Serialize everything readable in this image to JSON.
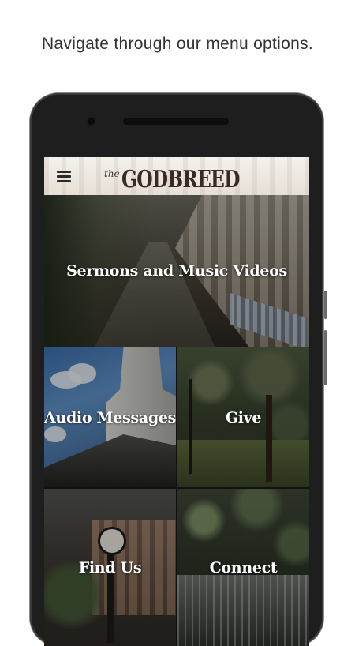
{
  "caption": "Navigate through our menu options.",
  "app": {
    "logo_small": "the",
    "logo_main": "GODBREED"
  },
  "tiles": [
    {
      "label": "Sermons and Music Videos"
    },
    {
      "label": "Audio Messages"
    },
    {
      "label": "Give"
    },
    {
      "label": "Find Us"
    },
    {
      "label": "Connect"
    }
  ],
  "colors": {
    "page_background": "#ffffff",
    "phone_body": "#1e1e1e",
    "appbar": "#f1ede6",
    "logo": "#3b2a22",
    "tile_label": "#ffffff"
  },
  "icons": {
    "menu": "hamburger-menu-icon"
  }
}
